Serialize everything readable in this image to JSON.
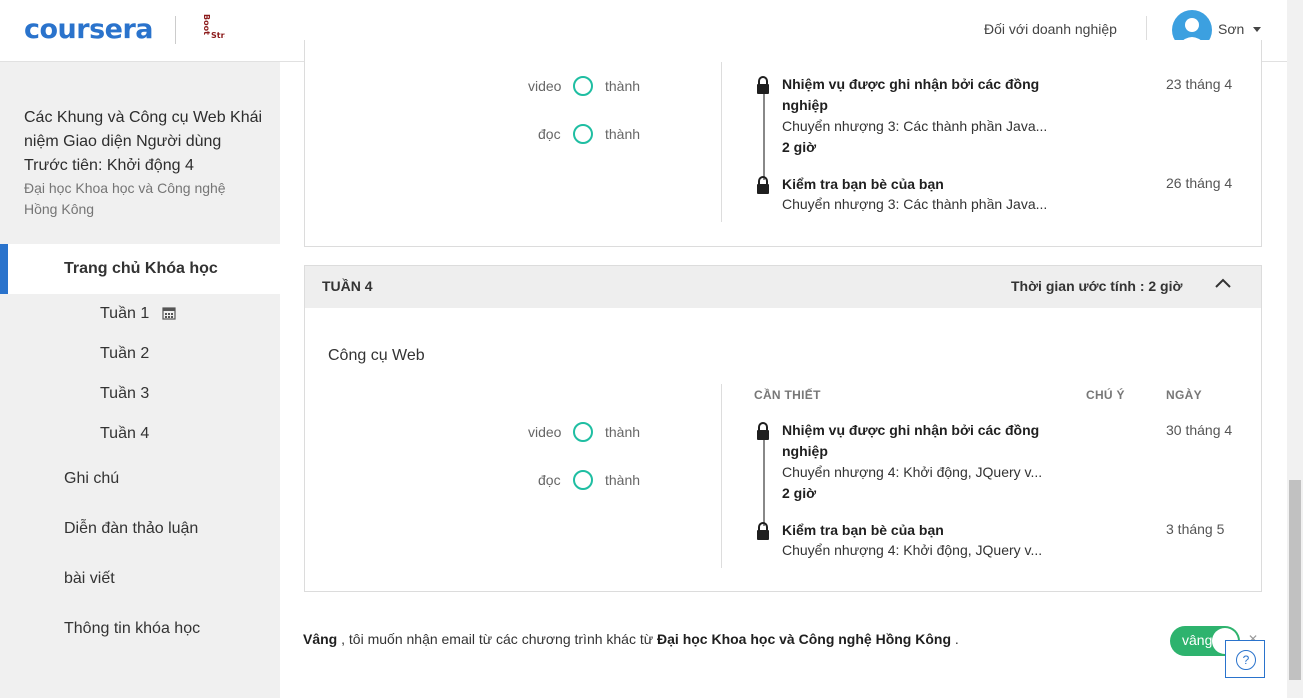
{
  "header": {
    "logo": "coursera",
    "partner_logo": "Boot Strap",
    "business_link": "Đối với doanh nghiệp",
    "user_name": "Sơn"
  },
  "sidebar": {
    "course_title": "Các Khung và Công cụ Web Khái niệm Giao diện Người dùng Trước tiên: Khởi động 4",
    "university": "Đại học Khoa học và Công nghệ Hồng Kông",
    "home": "Trang chủ Khóa học",
    "weeks": [
      "Tuần 1",
      "Tuần 2",
      "Tuần 3",
      "Tuần 4"
    ],
    "notes": "Ghi chú",
    "forums": "Diễn đàn thảo luận",
    "articles": "bài viết",
    "info": "Thông tin khóa học"
  },
  "week3": {
    "progress": [
      {
        "label": "video",
        "status": "thành"
      },
      {
        "label": "đọc",
        "status": "thành"
      }
    ],
    "items": [
      {
        "title": "Nhiệm vụ được ghi nhận bởi các đồng nghiệp",
        "subtitle": "Chuyển nhượng 3: Các thành phần Java...",
        "duration": "2 giờ",
        "date": "23 tháng 4"
      },
      {
        "title": "Kiểm tra bạn bè của bạn",
        "subtitle": "Chuyển nhượng 3: Các thành phần Java...",
        "date": "26 tháng 4"
      }
    ]
  },
  "week4": {
    "label": "TUẦN 4",
    "estimate": "Thời gian ước tính : 2 giờ",
    "module_title": "Công cụ Web",
    "col_required": "CẦN THIẾT",
    "col_note": "CHÚ Ý",
    "col_date": "NGÀY",
    "progress": [
      {
        "label": "video",
        "status": "thành"
      },
      {
        "label": "đọc",
        "status": "thành"
      }
    ],
    "items": [
      {
        "title": "Nhiệm vụ được ghi nhận bởi các đồng nghiệp",
        "subtitle": "Chuyển nhượng 4: Khởi động, JQuery v...",
        "duration": "2 giờ",
        "date": "30 tháng 4"
      },
      {
        "title": "Kiểm tra bạn bè của bạn",
        "subtitle": "Chuyển nhượng 4: Khởi động, JQuery v...",
        "date": "3 tháng 5"
      }
    ]
  },
  "footer": {
    "yes": "Vâng",
    "text": ", tôi muốn nhận email từ các chương trình khác từ",
    "university": "Đại học Khoa học và Công nghệ Hồng Kông",
    "period": ".",
    "toggle_label": "vâng"
  },
  "help": {
    "icon": "?"
  },
  "colors": {
    "brand": "#2a73cc",
    "ring": "#1fbea2",
    "toggle": "#2eb36e"
  }
}
